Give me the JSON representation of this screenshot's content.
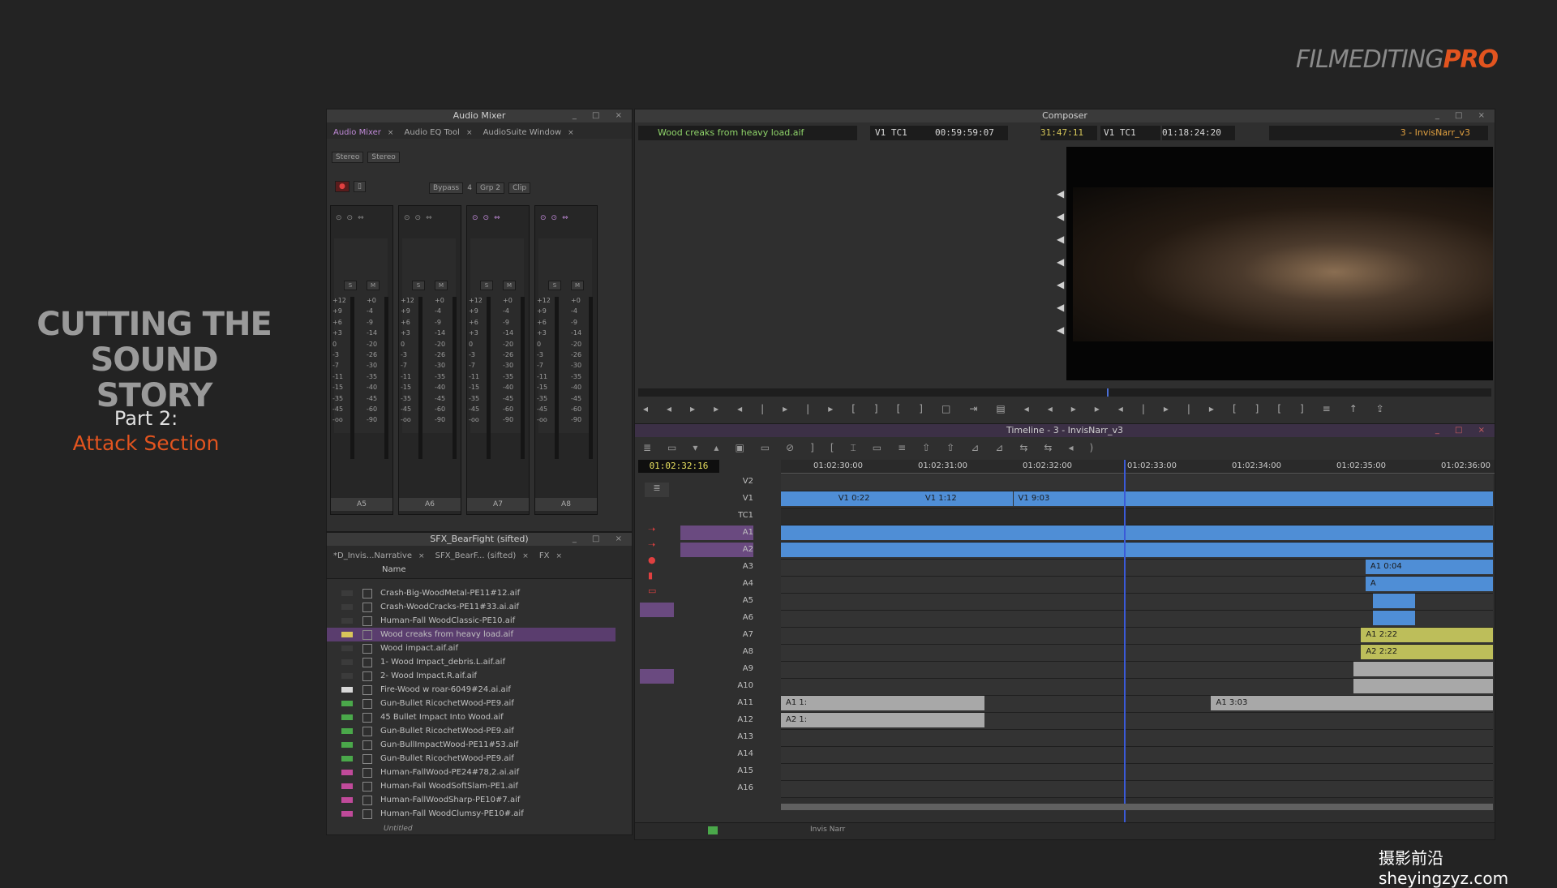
{
  "slide": {
    "title_line1": "CUTTING THE",
    "title_line2": "SOUND STORY",
    "part": "Part 2:",
    "section": "Attack Section"
  },
  "logo": {
    "film": "FILM",
    "editing": "EDITING",
    "pro": "PRO"
  },
  "watermark": "摄影前沿 sheyingzyz.com",
  "audio_mixer": {
    "title": "Audio Mixer",
    "tabs": [
      "Audio Mixer",
      "Audio EQ Tool",
      "AudioSuite Window"
    ],
    "mode_left": "Stereo",
    "mode_right": "Stereo",
    "bypass": "Bypass",
    "bypass_val": "4",
    "grp": "Grp 2",
    "clip": "Clip",
    "scale_left": [
      "+12",
      "+9",
      "+6",
      "+3",
      "0",
      "-3",
      "-7",
      "-11",
      "-15",
      "-35",
      "-45",
      "-oo"
    ],
    "scale_right": [
      "+0",
      "-4",
      "-9",
      "-14",
      "-20",
      "-26",
      "-30",
      "-35",
      "-40",
      "-45",
      "-60",
      "-90"
    ],
    "channels": [
      "A5",
      "A6",
      "A7",
      "A8"
    ],
    "solo": "S",
    "mute": "M"
  },
  "bin": {
    "title": "SFX_BearFight (sifted)",
    "tabs": [
      "*D_Invis...Narrative",
      "SFX_BearF... (sifted)",
      "FX"
    ],
    "column": "Name",
    "items": [
      {
        "name": "Crash-Big-WoodMetal-PE11#12.aif",
        "color": "#3b3b3b"
      },
      {
        "name": "Crash-WoodCracks-PE11#33.ai.aif",
        "color": "#3b3b3b"
      },
      {
        "name": "Human-Fall WoodClassic-PE10.aif",
        "color": "#3b3b3b"
      },
      {
        "name": "Wood creaks from heavy load.aif",
        "color": "#d9c55a"
      },
      {
        "name": "Wood impact.aif.aif",
        "color": "#3b3b3b"
      },
      {
        "name": "1- Wood Impact_debris.L.aif.aif",
        "color": "#3b3b3b"
      },
      {
        "name": "2- Wood Impact.R.aif.aif",
        "color": "#3b3b3b"
      },
      {
        "name": "Fire-Wood w roar-6049#24.ai.aif",
        "color": "#d8d8d8"
      },
      {
        "name": "Gun-Bullet RicochetWood-PE9.aif",
        "color": "#4aa84a"
      },
      {
        "name": "45 Bullet Impact Into Wood.aif",
        "color": "#4aa84a"
      },
      {
        "name": "Gun-Bullet RicochetWood-PE9.aif",
        "color": "#4aa84a"
      },
      {
        "name": "Gun-BullImpactWood-PE11#53.aif",
        "color": "#4aa84a"
      },
      {
        "name": "Gun-Bullet RicochetWood-PE9.aif",
        "color": "#4aa84a"
      },
      {
        "name": "Human-FallWood-PE24#78,2.ai.aif",
        "color": "#c04a9a"
      },
      {
        "name": "Human-Fall WoodSoftSlam-PE1.aif",
        "color": "#c04a9a"
      },
      {
        "name": "Human-FallWoodSharp-PE10#7.aif",
        "color": "#c04a9a"
      },
      {
        "name": "Human-Fall WoodClumsy-PE10#.aif",
        "color": "#c04a9a"
      }
    ],
    "footer": "Untitled"
  },
  "composer": {
    "title": "Composer",
    "source_clip": "Wood creaks from heavy load.aif",
    "tc_label1": "V1 TC1",
    "tc1": "00:59:59:07",
    "tc2": "31:47:11",
    "tc_label2": "V1 TC1",
    "tc3": "01:18:24:20",
    "record_seq": "3 - InvisNarr_v3"
  },
  "timeline": {
    "title": "Timeline - 3 - InvisNarr_v3",
    "current_tc": "01:02:32:16",
    "ruler": [
      "01:02:30:00",
      "01:02:31:00",
      "01:02:32:00",
      "01:02:33:00",
      "01:02:34:00",
      "01:02:35:00",
      "01:02:36:00"
    ],
    "tracks": [
      "V2",
      "V1",
      "TC1",
      "A1",
      "A2",
      "A3",
      "A4",
      "A5",
      "A6",
      "A7",
      "A8",
      "A9",
      "A10",
      "A11",
      "A12",
      "A13",
      "A14",
      "A15",
      "A16"
    ],
    "v1_clips": [
      "V1 0:22",
      "V1 1:12",
      "V1 9:03"
    ],
    "a1_label": "A1",
    "a2_label": "A2",
    "a3_clip": "A1 0:04",
    "a4_clip": "A",
    "a7_clip": "A1 2:22",
    "a8_clip": "A2 2:22",
    "a11_clip1": "A1 1:",
    "a11_clip2": "A1 3:03",
    "a12_clip": "A2 1:",
    "footer_seq": "Invis Narr"
  }
}
